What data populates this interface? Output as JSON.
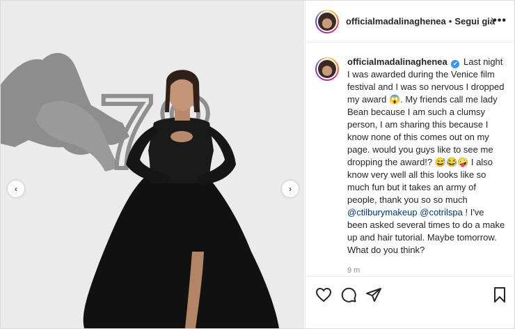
{
  "post": {
    "username": "officialmadalinaghenea",
    "separator": "•",
    "follow_label": "Segui già",
    "more_label": "•••",
    "verified_mark": "✔",
    "caption_body": " Last night I was awarded during the Venice film festival and I was so nervous I dropped my award 😱. My friends call me lady Bean because I am such a clumsy person, I am sharing this because I know none of this comes out on my page. would you guys like to see me dropping the award!? 😅😂🤪 I also know very well all this looks like so much fun but it takes an army of people, thank you so so much ",
    "mention_1": "@ctilburymakeup",
    "mention_2": "@cotrilspa",
    "caption_end": " ! I've been asked several times to do a make up and hair tutorial. Maybe tomorrow. What do you think?",
    "timestamp": "9 m"
  },
  "photo": {
    "logo_number": "78",
    "prev_arrow": "‹",
    "next_arrow": "›"
  },
  "actions": {
    "like_icon": "heart-icon",
    "comment_icon": "comment-icon",
    "share_icon": "paper-plane-icon",
    "save_icon": "bookmark-icon"
  }
}
